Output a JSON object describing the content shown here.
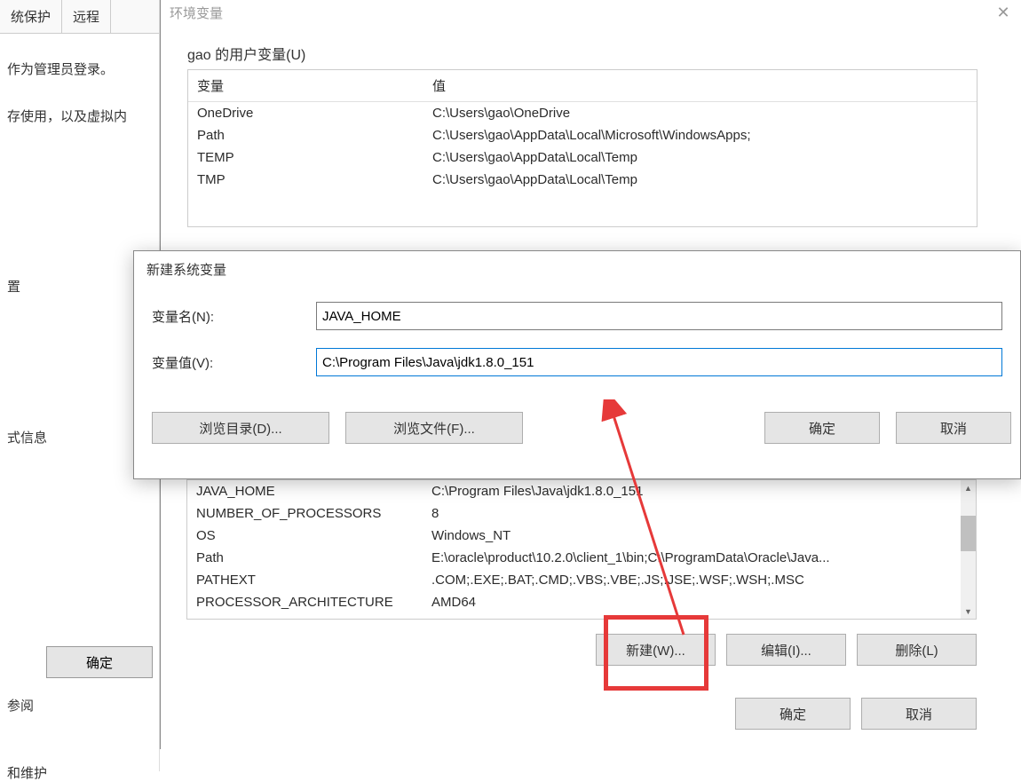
{
  "bg_window": {
    "tabs": [
      "统保护",
      "远程"
    ],
    "admin_text": "作为管理员登录。",
    "mem_text": "存使用，以及虚拟内",
    "info_text": "式信息",
    "config_text": "置",
    "ok_label": "确定",
    "see_label": "参阅",
    "maintain_label": "和维护"
  },
  "env_dialog": {
    "title": "环境变量",
    "user_vars_label": "gao 的用户变量(U)",
    "table_headers": {
      "variable": "变量",
      "value": "值"
    },
    "user_vars": [
      {
        "name": "OneDrive",
        "value": "C:\\Users\\gao\\OneDrive"
      },
      {
        "name": "Path",
        "value": "C:\\Users\\gao\\AppData\\Local\\Microsoft\\WindowsApps;"
      },
      {
        "name": "TEMP",
        "value": "C:\\Users\\gao\\AppData\\Local\\Temp"
      },
      {
        "name": "TMP",
        "value": "C:\\Users\\gao\\AppData\\Local\\Temp"
      }
    ],
    "system_vars": [
      {
        "name": "JAVA_HOME",
        "value": "C:\\Program Files\\Java\\jdk1.8.0_151"
      },
      {
        "name": "NUMBER_OF_PROCESSORS",
        "value": "8"
      },
      {
        "name": "OS",
        "value": "Windows_NT"
      },
      {
        "name": "Path",
        "value": "E:\\oracle\\product\\10.2.0\\client_1\\bin;C:\\ProgramData\\Oracle\\Java..."
      },
      {
        "name": "PATHEXT",
        "value": ".COM;.EXE;.BAT;.CMD;.VBS;.VBE;.JS;.JSE;.WSF;.WSH;.MSC"
      },
      {
        "name": "PROCESSOR_ARCHITECTURE",
        "value": "AMD64"
      }
    ],
    "buttons": {
      "new": "新建(W)...",
      "edit": "编辑(I)...",
      "delete": "删除(L)",
      "ok": "确定",
      "cancel": "取消"
    }
  },
  "new_var_dialog": {
    "title": "新建系统变量",
    "name_label": "变量名(N):",
    "value_label": "变量值(V):",
    "name_value": "JAVA_HOME",
    "value_value": "C:\\Program Files\\Java\\jdk1.8.0_151",
    "browse_dir": "浏览目录(D)...",
    "browse_file": "浏览文件(F)...",
    "ok": "确定",
    "cancel": "取消"
  }
}
